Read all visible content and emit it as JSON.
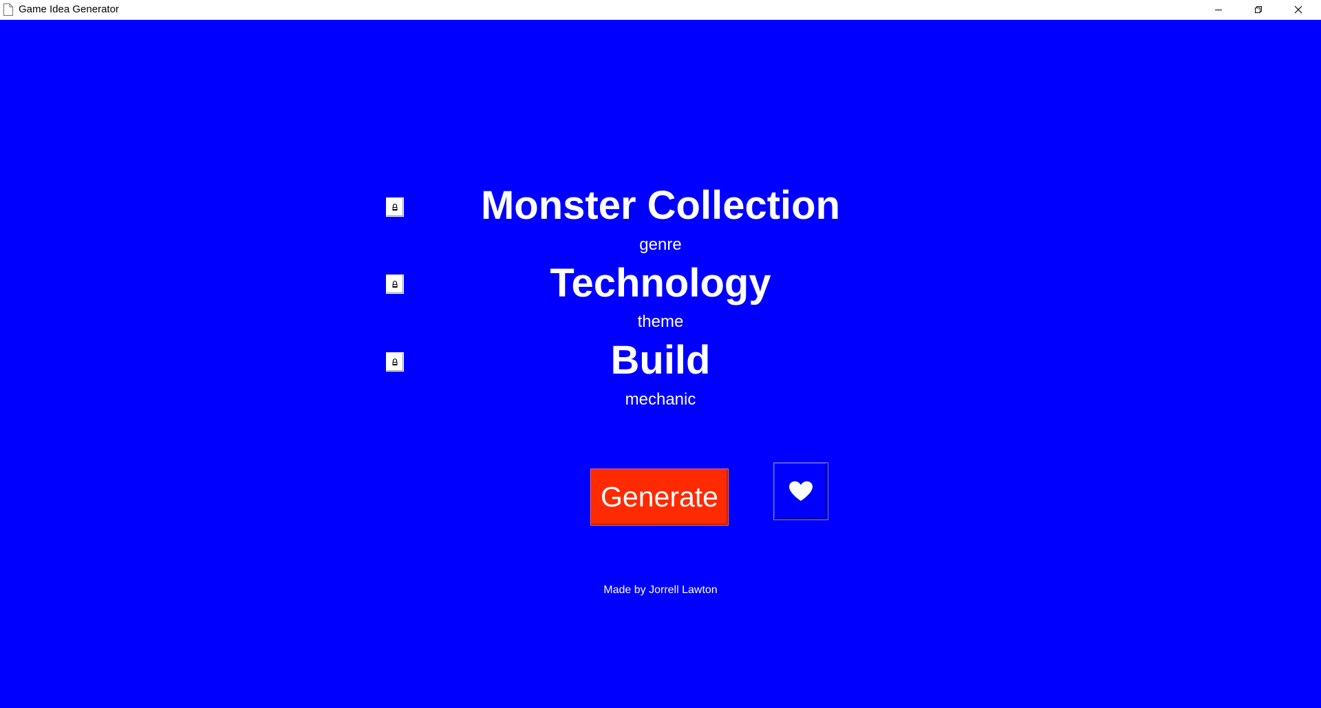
{
  "window": {
    "title": "Game Idea Generator",
    "background_color": "#0000FF",
    "controls": {
      "minimize_icon": "minimize-icon",
      "restore_icon": "restore-icon",
      "close_icon": "close-icon"
    }
  },
  "idea_rows": [
    {
      "value": "Monster Collection",
      "category": "genre",
      "lock_icon": "lock-icon",
      "locked": false
    },
    {
      "value": "Technology",
      "category": "theme",
      "lock_icon": "lock-icon",
      "locked": false
    },
    {
      "value": "Build",
      "category": "mechanic",
      "lock_icon": "lock-icon",
      "locked": false
    }
  ],
  "actions": {
    "generate_label": "Generate",
    "generate_color": "#FF2A00",
    "favorite_icon": "heart-icon"
  },
  "footer": {
    "credit": "Made by Jorrell Lawton"
  }
}
